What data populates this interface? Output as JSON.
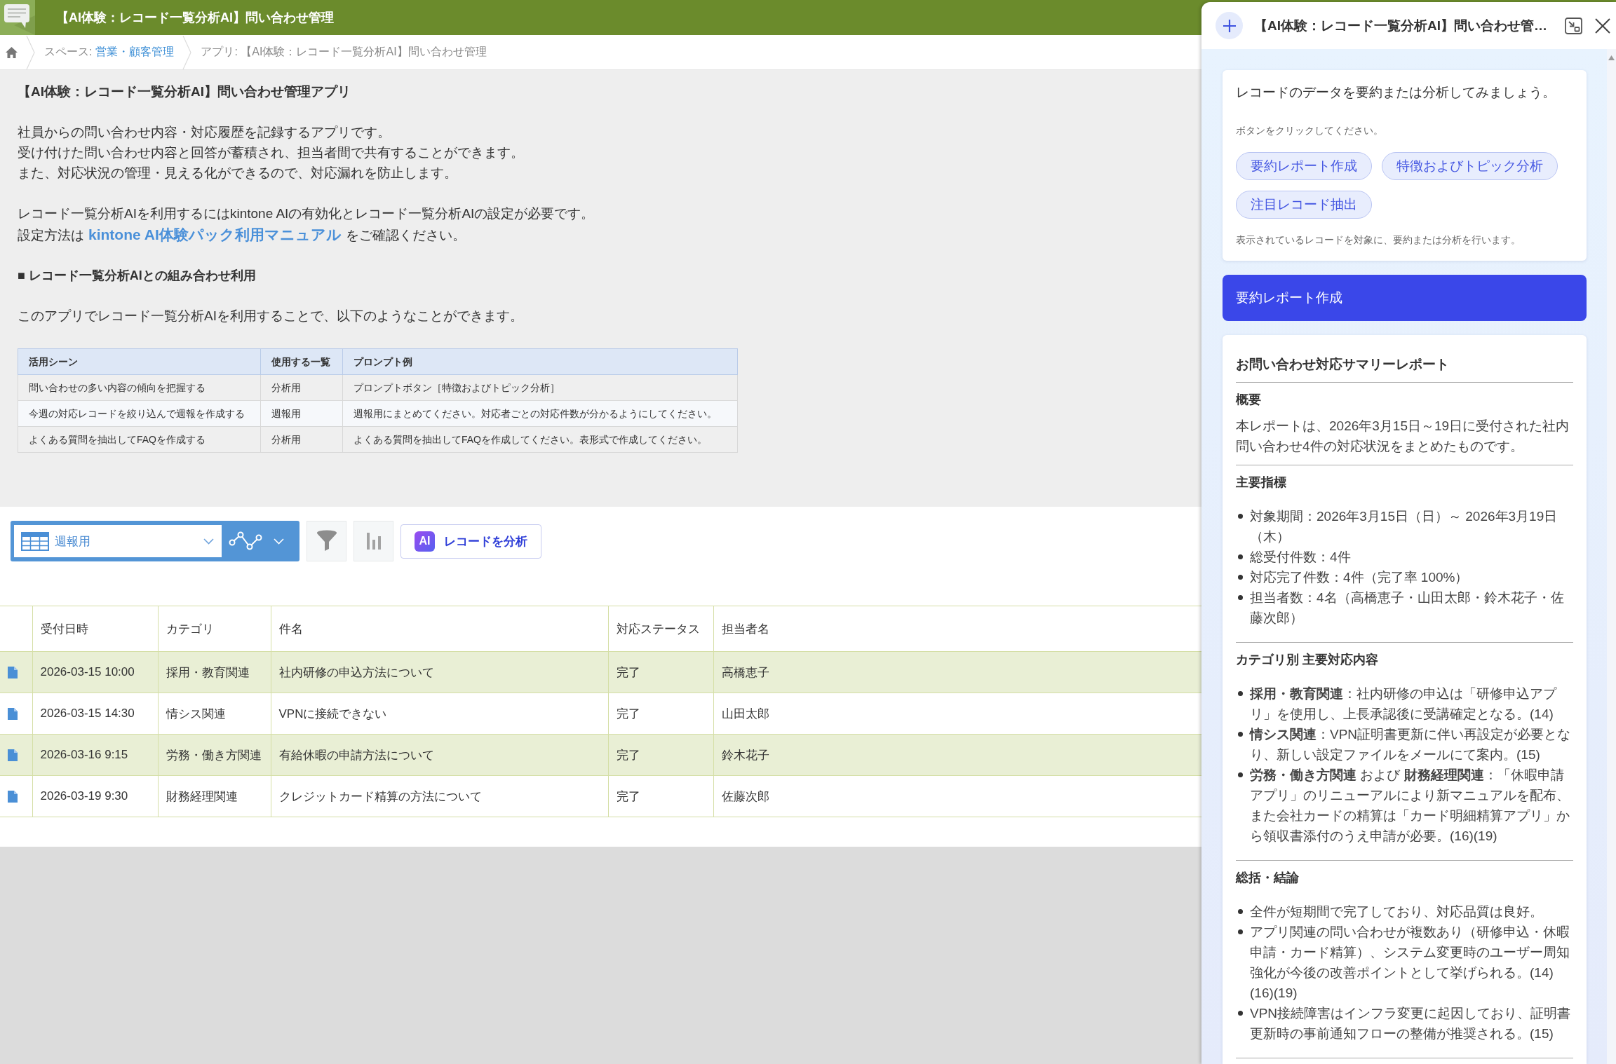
{
  "app_header": {
    "title": "【AI体験：レコード一覧分析AI】問い合わせ管理"
  },
  "breadcrumb": {
    "space_label": "スペース:",
    "space_name": "営業・顧客管理",
    "app_path": "アプリ: 【AI体験：レコード一覧分析AI】問い合わせ管理"
  },
  "app_description": {
    "title": "【AI体験：レコード一覧分析AI】問い合わせ管理アプリ",
    "intro_lines": [
      "社員からの問い合わせ内容・対応履歴を記録するアプリです。",
      "受け付けた問い合わせ内容と回答が蓄積され、担当者間で共有することができます。",
      "また、対応状況の管理・見える化ができるので、対応漏れを防止します。"
    ],
    "setup": {
      "lines": [
        "レコード一覧分析AIを利用するにはkintone AIの有効化とレコード一覧分析AIの設定が必要です。"
      ],
      "link_before": "設定方法は",
      "link": "kintone AI体験パック利用マニュアル",
      "link_after": "をご確認ください。"
    },
    "section_heading": "■ レコード一覧分析AIとの組み合わせ利用",
    "section_text": "このアプリでレコード一覧分析AIを利用することで、以下のようなことができます。",
    "usage_table": {
      "columns": [
        "活用シーン",
        "使用する一覧",
        "プロンプト例"
      ],
      "rows": [
        [
          "問い合わせの多い内容の傾向を把握する",
          "分析用",
          "プロンプトボタン［特徴およびトピック分析］"
        ],
        [
          "今週の対応レコードを絞り込んで週報を作成する",
          "週報用",
          "週報用にまとめてください。対応者ごとの対応件数が分かるようにしてください。"
        ],
        [
          "よくある質問を抽出してFAQを作成する",
          "分析用",
          "よくある質問を抽出してFAQを作成してください。表形式で作成してください。"
        ]
      ]
    }
  },
  "toolbar": {
    "view_name": "週報用",
    "analyze_button": {
      "badge": "AI",
      "label": "レコードを分析"
    }
  },
  "records_table": {
    "columns": [
      "受付日時",
      "カテゴリ",
      "件名",
      "対応ステータス",
      "担当者名"
    ],
    "rows": [
      {
        "cells": [
          "2026-03-15 10:00",
          "採用・教育関連",
          "社内研修の申込方法について",
          "完了",
          "高橋恵子"
        ]
      },
      {
        "cells": [
          "2026-03-15 14:30",
          "情シス関連",
          "VPNに接続できない",
          "完了",
          "山田太郎"
        ]
      },
      {
        "cells": [
          "2026-03-16 9:15",
          "労務・働き方関連",
          "有給休暇の申請方法について",
          "完了",
          "鈴木花子"
        ]
      },
      {
        "cells": [
          "2026-03-19 9:30",
          "財務経理関連",
          "クレジットカード精算の方法について",
          "完了",
          "佐藤次郎"
        ]
      }
    ]
  },
  "ai_panel": {
    "title": "【AI体験：レコード一覧分析AI】問い合わせ管…",
    "intro_card": {
      "greeting": "レコードのデータを要約または分析してみましょう。",
      "instruction": "ボタンをクリックしてください。",
      "prompt_buttons": [
        "要約レポート作成",
        "特徴およびトピック分析",
        "注目レコード抽出"
      ],
      "note": "表示されているレコードを対象に、要約または分析を行います。"
    },
    "user_message": "要約レポート作成",
    "report": {
      "title": "お問い合わせ対応サマリーレポート",
      "sections": [
        {
          "heading": "概要",
          "kind": "paragraph",
          "text": "本レポートは、2026年3月15日～19日に受付された社内問い合わせ4件の対応状況をまとめたものです。"
        },
        {
          "heading": "主要指標",
          "kind": "list",
          "items": [
            "対象期間：2026年3月15日（日）～ 2026年3月19日（木）",
            "総受付件数：4件",
            "対応完了件数：4件（完了率 100%）",
            "担当者数：4名（高橋恵子・山田太郎・鈴木花子・佐藤次郎）"
          ]
        },
        {
          "heading": "カテゴリ別 主要対応内容",
          "kind": "list",
          "items": [
            "**採用・教育関連**：社内研修の申込は「研修申込アプリ」を使用し、上長承認後に受講確定となる。(14)",
            "**情シス関連**：VPN証明書更新に伴い再設定が必要となり、新しい設定ファイルをメールにて案内。(15)",
            "**労務・働き方関連** および **財務経理関連**：「休暇申請アプリ」のリニューアルにより新マニュアルを配布、また会社カードの精算は「カード明細精算アプリ」から領収書添付のうえ申請が必要。(16)(19)"
          ]
        },
        {
          "heading": "総括・結論",
          "kind": "list",
          "items": [
            "全件が短期間で完了しており、対応品質は良好。",
            "アプリ関連の問い合わせが複数あり（研修申込・休暇申請・カード精算）、システム変更時のユーザー周知強化が今後の改善ポイントとして挙げられる。(14)(16)(19)",
            "VPN接続障害はインフラ変更に起因しており、証明書更新時の事前通知フローの整備が推奨される。(15)"
          ]
        }
      ]
    }
  }
}
